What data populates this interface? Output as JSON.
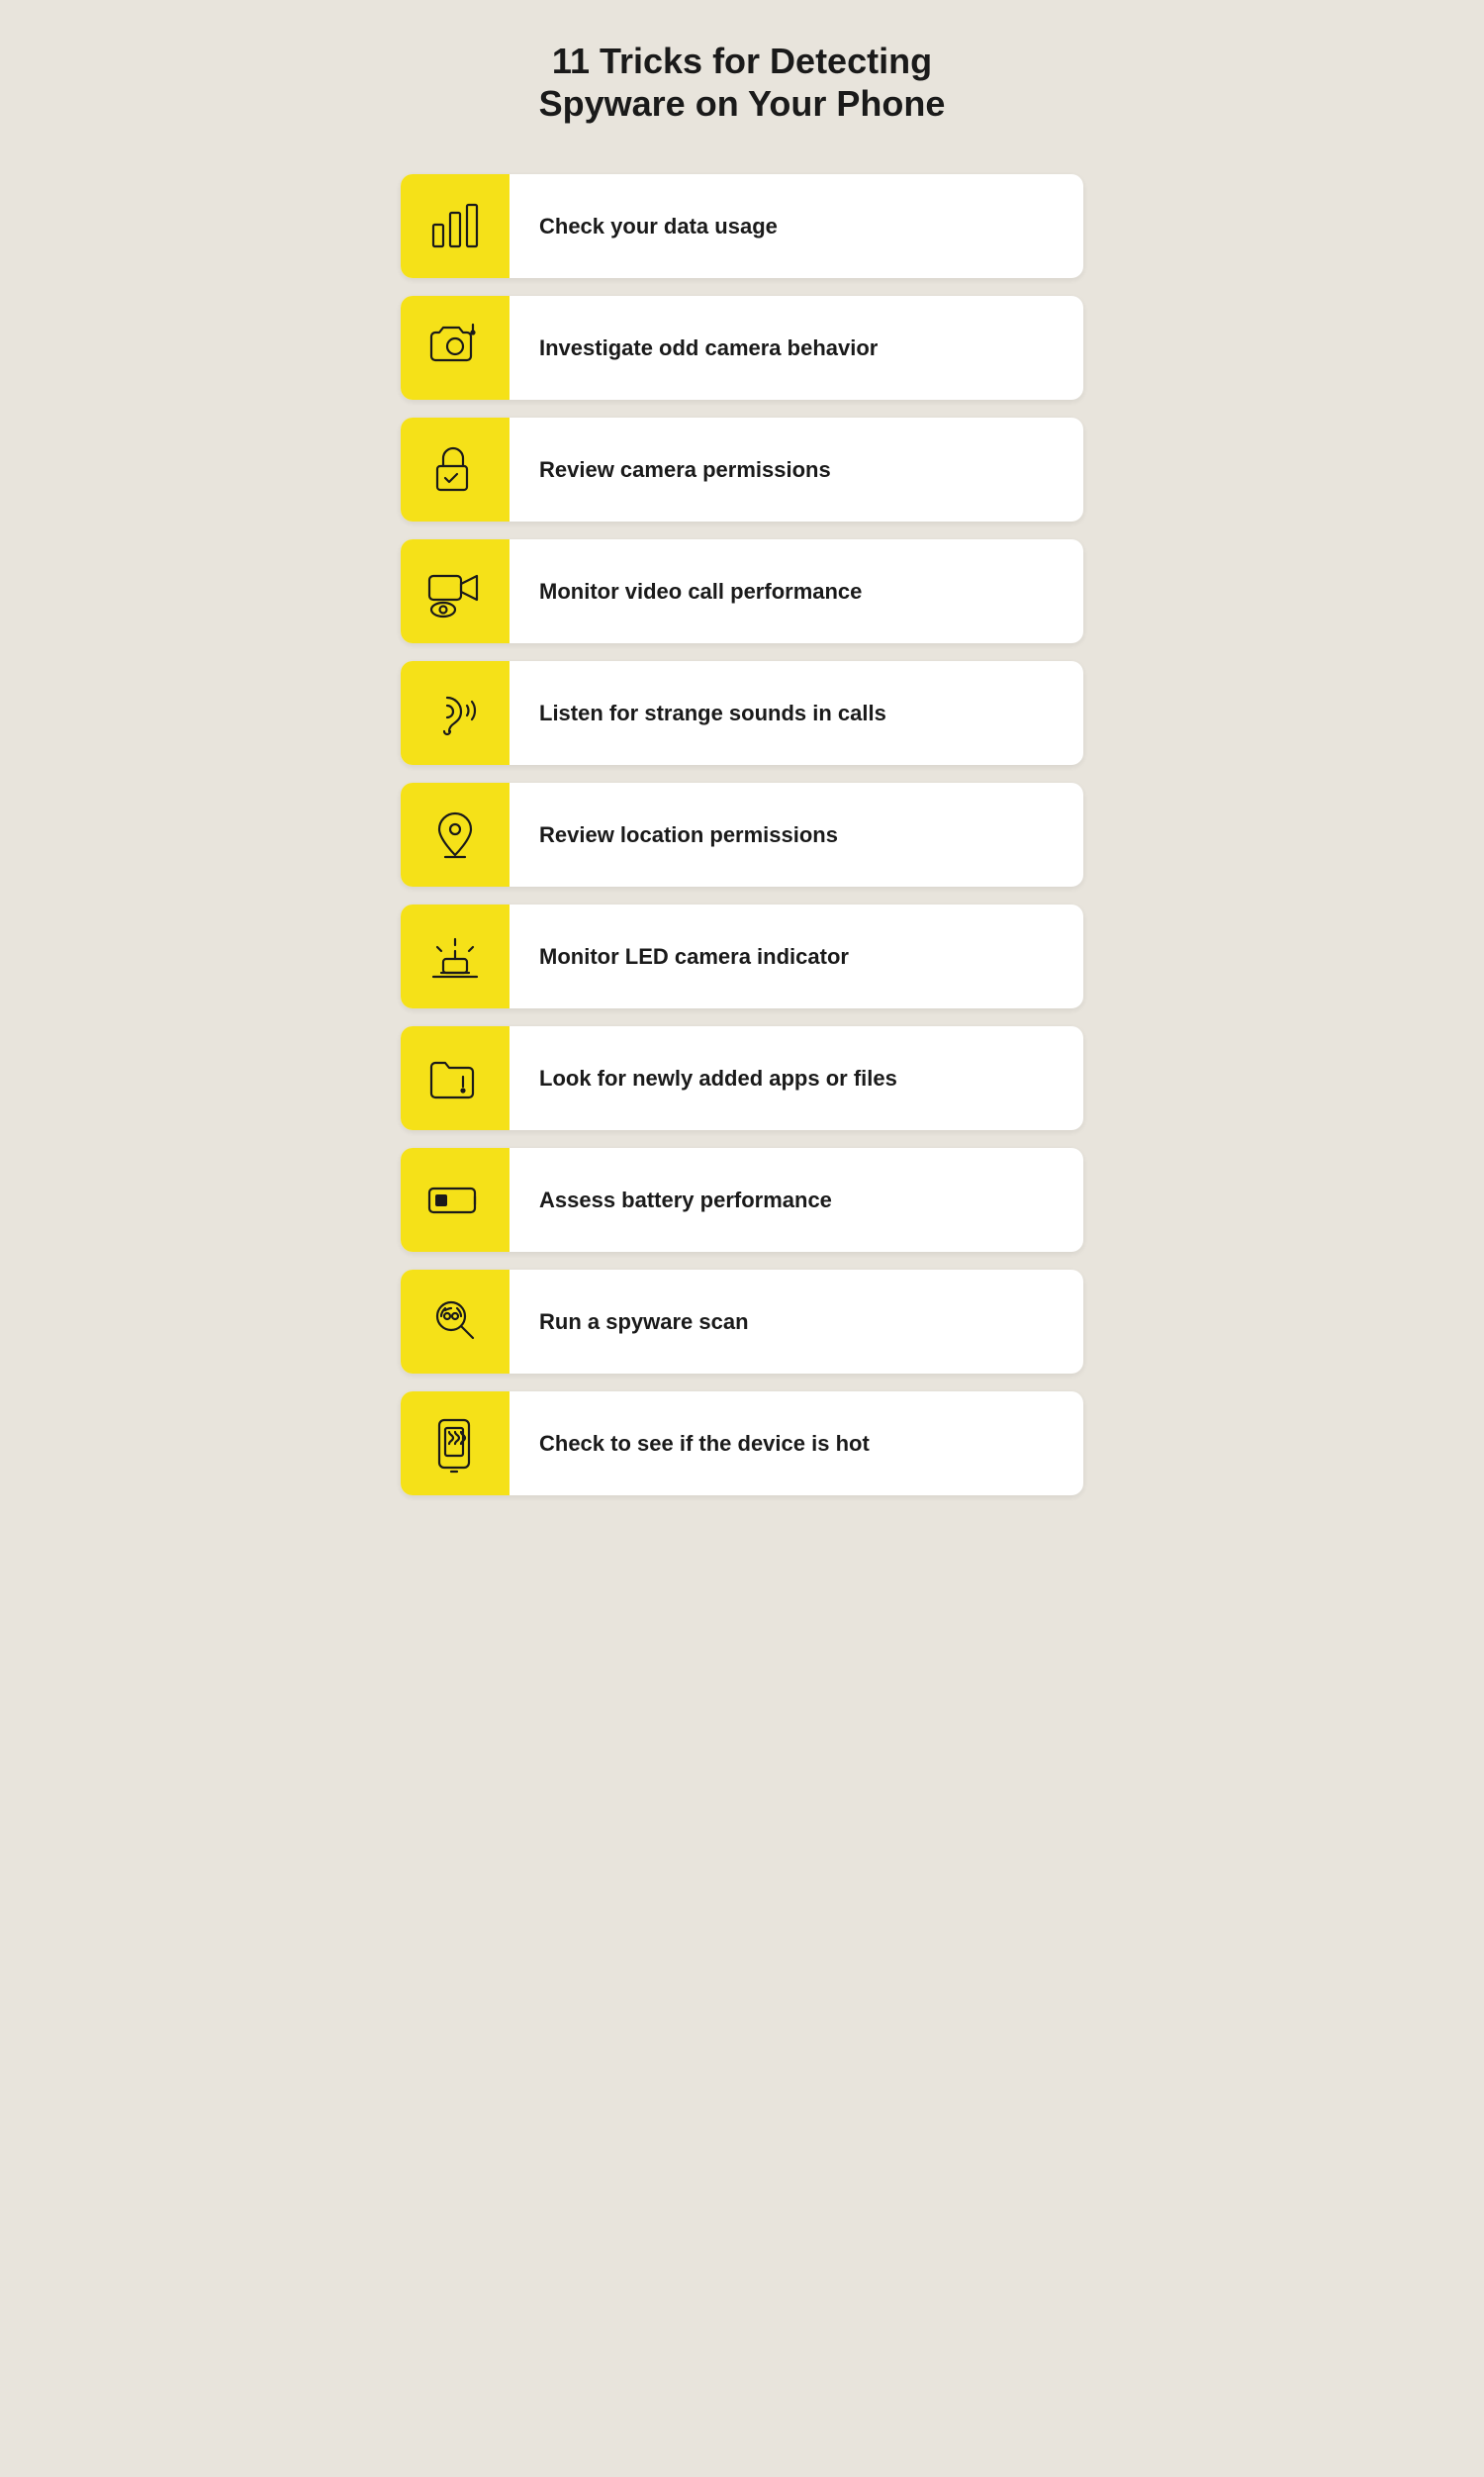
{
  "page": {
    "title_line1": "11 Tricks for Detecting",
    "title_line2": "Spyware on Your Phone",
    "background_color": "#e8e4dc",
    "accent_color": "#f5e118"
  },
  "items": [
    {
      "id": 1,
      "label": "Check your data usage",
      "icon": "bar-chart"
    },
    {
      "id": 2,
      "label": "Investigate odd camera behavior",
      "icon": "camera-alert"
    },
    {
      "id": 3,
      "label": "Review camera permissions",
      "icon": "lock-check"
    },
    {
      "id": 4,
      "label": "Monitor video call performance",
      "icon": "video-eye"
    },
    {
      "id": 5,
      "label": "Listen for strange sounds in calls",
      "icon": "ear-wave"
    },
    {
      "id": 6,
      "label": "Review location permissions",
      "icon": "location-pin"
    },
    {
      "id": 7,
      "label": "Monitor LED camera indicator",
      "icon": "alarm-light"
    },
    {
      "id": 8,
      "label": "Look for newly added apps or files",
      "icon": "folder-alert"
    },
    {
      "id": 9,
      "label": "Assess battery performance",
      "icon": "battery-low"
    },
    {
      "id": 10,
      "label": "Run a spyware scan",
      "icon": "spy-scan"
    },
    {
      "id": 11,
      "label": "Check to see if the device is hot",
      "icon": "phone-hot"
    }
  ]
}
